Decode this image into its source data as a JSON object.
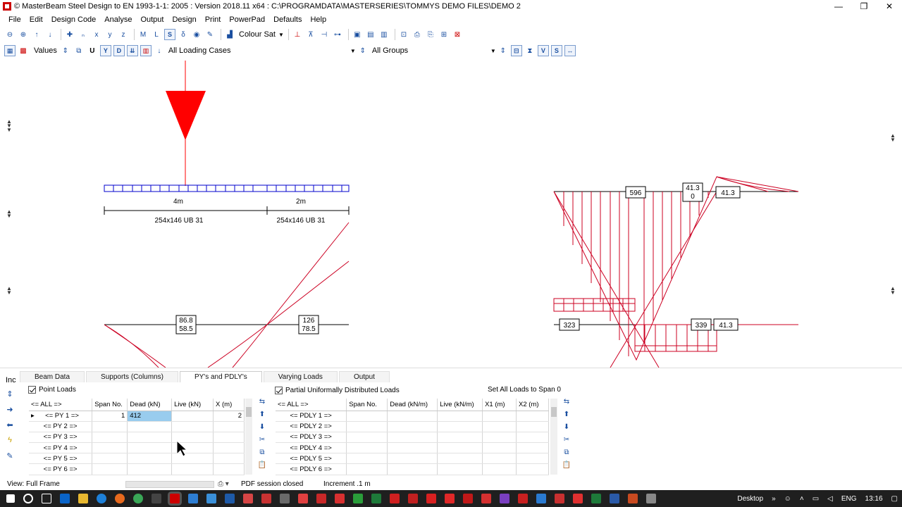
{
  "window": {
    "title": "© MasterBeam Steel Design to EN 1993-1-1: 2005 : Version 2018.11 x64 : C:\\PROGRAMDATA\\MASTERSERIES\\TOMMYS DEMO FILES\\DEMO 2",
    "minimize": "—",
    "restore": "❐",
    "close": "✕"
  },
  "menu": [
    "File",
    "Edit",
    "Design Code",
    "Analyse",
    "Output",
    "Design",
    "Print",
    "PowerPad",
    "Defaults",
    "Help"
  ],
  "toolbar1": {
    "colour_sat_label": "Colour Sat"
  },
  "toolbar2": {
    "values_label": "Values",
    "btn_u": "U",
    "btn_y": "Y",
    "btn_d": "D",
    "loading_cases": "All Loading Cases",
    "groups": "All Groups",
    "btn_v": "V",
    "btn_s": "S"
  },
  "diagram": {
    "span1_label": "4m",
    "span2_label": "2m",
    "section1": "254x146 UB 31",
    "section2": "254x146 UB 31",
    "left_box1": [
      "86.8",
      "58.5"
    ],
    "left_box2": [
      "126",
      "78.5"
    ],
    "right_top_box1": "596",
    "right_top_box2": [
      "41.3",
      "0"
    ],
    "right_top_box3": "41.3",
    "right_bottom_box1": "323",
    "right_bottom_box2": "339",
    "right_bottom_box3": "41.3",
    "load_color": "#ff0000",
    "beam_color": "#0000cc",
    "diagram_color": "#cc0022"
  },
  "bottom": {
    "inc_label": "Inc",
    "tabs": [
      "Beam Data",
      "Supports (Columns)",
      "PY's and PDLY's",
      "Varying Loads",
      "Output"
    ],
    "active_tab": "PY's and PDLY's",
    "point_loads": {
      "checkbox_label": "Point Loads",
      "headers": [
        "<= ALL =>",
        "Span No.",
        "Dead (kN)",
        "Live (kN)",
        "X (m)"
      ],
      "rows": [
        {
          "marker": "▸",
          "label": "<= PY 1 =>",
          "span": "1",
          "dead": "412",
          "live": "",
          "x": "2"
        },
        {
          "marker": "",
          "label": "<= PY 2 =>",
          "span": "",
          "dead": "",
          "live": "",
          "x": ""
        },
        {
          "marker": "",
          "label": "<= PY 3 =>",
          "span": "",
          "dead": "",
          "live": "",
          "x": ""
        },
        {
          "marker": "",
          "label": "<= PY 4 =>",
          "span": "",
          "dead": "",
          "live": "",
          "x": ""
        },
        {
          "marker": "",
          "label": "<= PY 5 =>",
          "span": "",
          "dead": "",
          "live": "",
          "x": ""
        },
        {
          "marker": "",
          "label": "<= PY 6 =>",
          "span": "",
          "dead": "",
          "live": "",
          "x": ""
        }
      ]
    },
    "pudl": {
      "checkbox_label": "Partial Uniformally Distributed Loads",
      "set_all_label": "Set All Loads to Span 0",
      "headers": [
        "<= ALL =>",
        "Span No.",
        "Dead (kN/m)",
        "Live (kN/m)",
        "X1 (m)",
        "X2 (m)"
      ],
      "rows": [
        {
          "label": "<= PDLY 1 =>"
        },
        {
          "label": "<= PDLY 2 =>"
        },
        {
          "label": "<= PDLY 3 =>"
        },
        {
          "label": "<= PDLY 4 =>"
        },
        {
          "label": "<= PDLY 5 =>"
        },
        {
          "label": "<= PDLY 6 =>"
        }
      ]
    }
  },
  "status": {
    "view": "View: Full Frame",
    "pdf": "PDF session closed",
    "increment": "Increment .1 m"
  },
  "taskbar": {
    "desktop": "Desktop",
    "lang": "ENG",
    "time": "13:16"
  }
}
